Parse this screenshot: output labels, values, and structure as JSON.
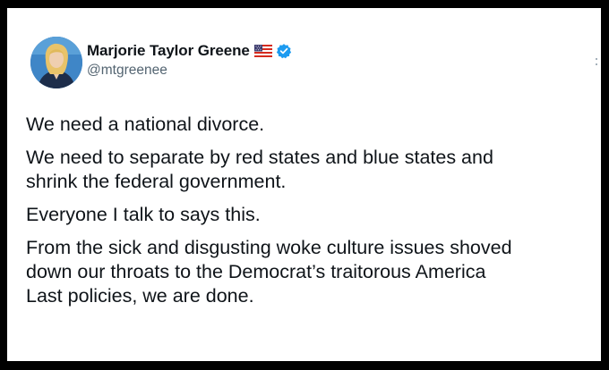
{
  "author": {
    "display_name": "Marjorie Taylor Greene",
    "handle": "@mtgreenee",
    "flag_icon": "us-flag-icon",
    "verified_icon": "verified-badge-icon",
    "verified_color": "#1d9bf0"
  },
  "tweet": {
    "paragraphs": [
      "We need a national divorce.",
      "We need to separate by red states and blue states and\nshrink the federal government.",
      "Everyone I talk to says this.",
      "From the sick and disgusting woke culture issues shoved\ndown our throats to the Democrat’s traitorous America\nLast policies, we are done."
    ]
  },
  "colors": {
    "frame": "#000000",
    "card": "#ffffff",
    "text_primary": "#0f1419",
    "text_secondary": "#536471"
  }
}
